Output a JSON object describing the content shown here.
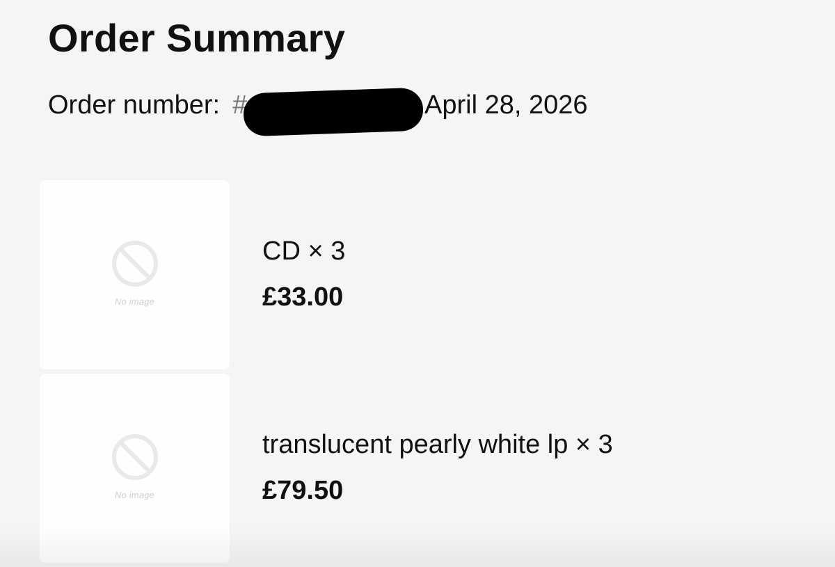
{
  "page": {
    "title": "Order Summary"
  },
  "order": {
    "number_label": "Order number:",
    "number_prefix": "#",
    "date": "April 28, 2026"
  },
  "items": [
    {
      "name": "CD × 3",
      "price": "£33.00",
      "image_placeholder": "No image",
      "icon": "no-image-icon"
    },
    {
      "name": "translucent pearly white lp × 3",
      "price": "£79.50",
      "image_placeholder": "No image",
      "icon": "no-image-icon"
    }
  ],
  "colors": {
    "background": "#f5f5f5",
    "card": "#fefefe",
    "text": "#111111",
    "redaction": "#000000",
    "placeholder": "#cfcfcf"
  }
}
